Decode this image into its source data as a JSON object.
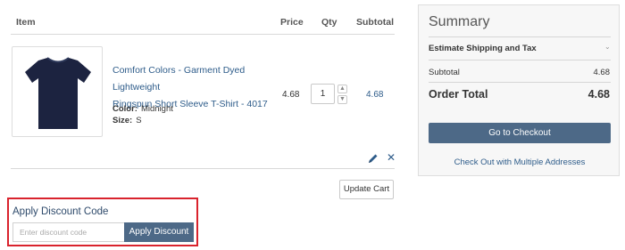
{
  "cart": {
    "headers": {
      "item": "Item",
      "price": "Price",
      "qty": "Qty",
      "subtotal": "Subtotal"
    },
    "item": {
      "name_line1": "Comfort Colors - Garment Dyed Lightweight",
      "name_line2": "Ringspun Short Sleeve T-Shirt - 4017",
      "options": [
        {
          "label": "Color:",
          "value": "Midnight"
        },
        {
          "label": "Size:",
          "value": "S"
        }
      ],
      "price": "4.68",
      "qty": "1",
      "subtotal": "4.68",
      "image_color": "#1c2340"
    },
    "update_label": "Update Cart",
    "remove_glyph": "✕"
  },
  "discount": {
    "title": "Apply Discount Code",
    "placeholder": "Enter discount code",
    "button_label": "Apply Discount",
    "highlight_color": "#d9232d"
  },
  "summary": {
    "title": "Summary",
    "shipping_label": "Estimate Shipping and Tax",
    "subtotal_label": "Subtotal",
    "subtotal_value": "4.68",
    "order_total_label": "Order Total",
    "order_total_value": "4.68",
    "checkout_label": "Go to Checkout",
    "multi_address_label": "Check Out with Multiple Addresses"
  },
  "colors": {
    "accent": "#4d6987",
    "link": "#2e5c8a"
  }
}
